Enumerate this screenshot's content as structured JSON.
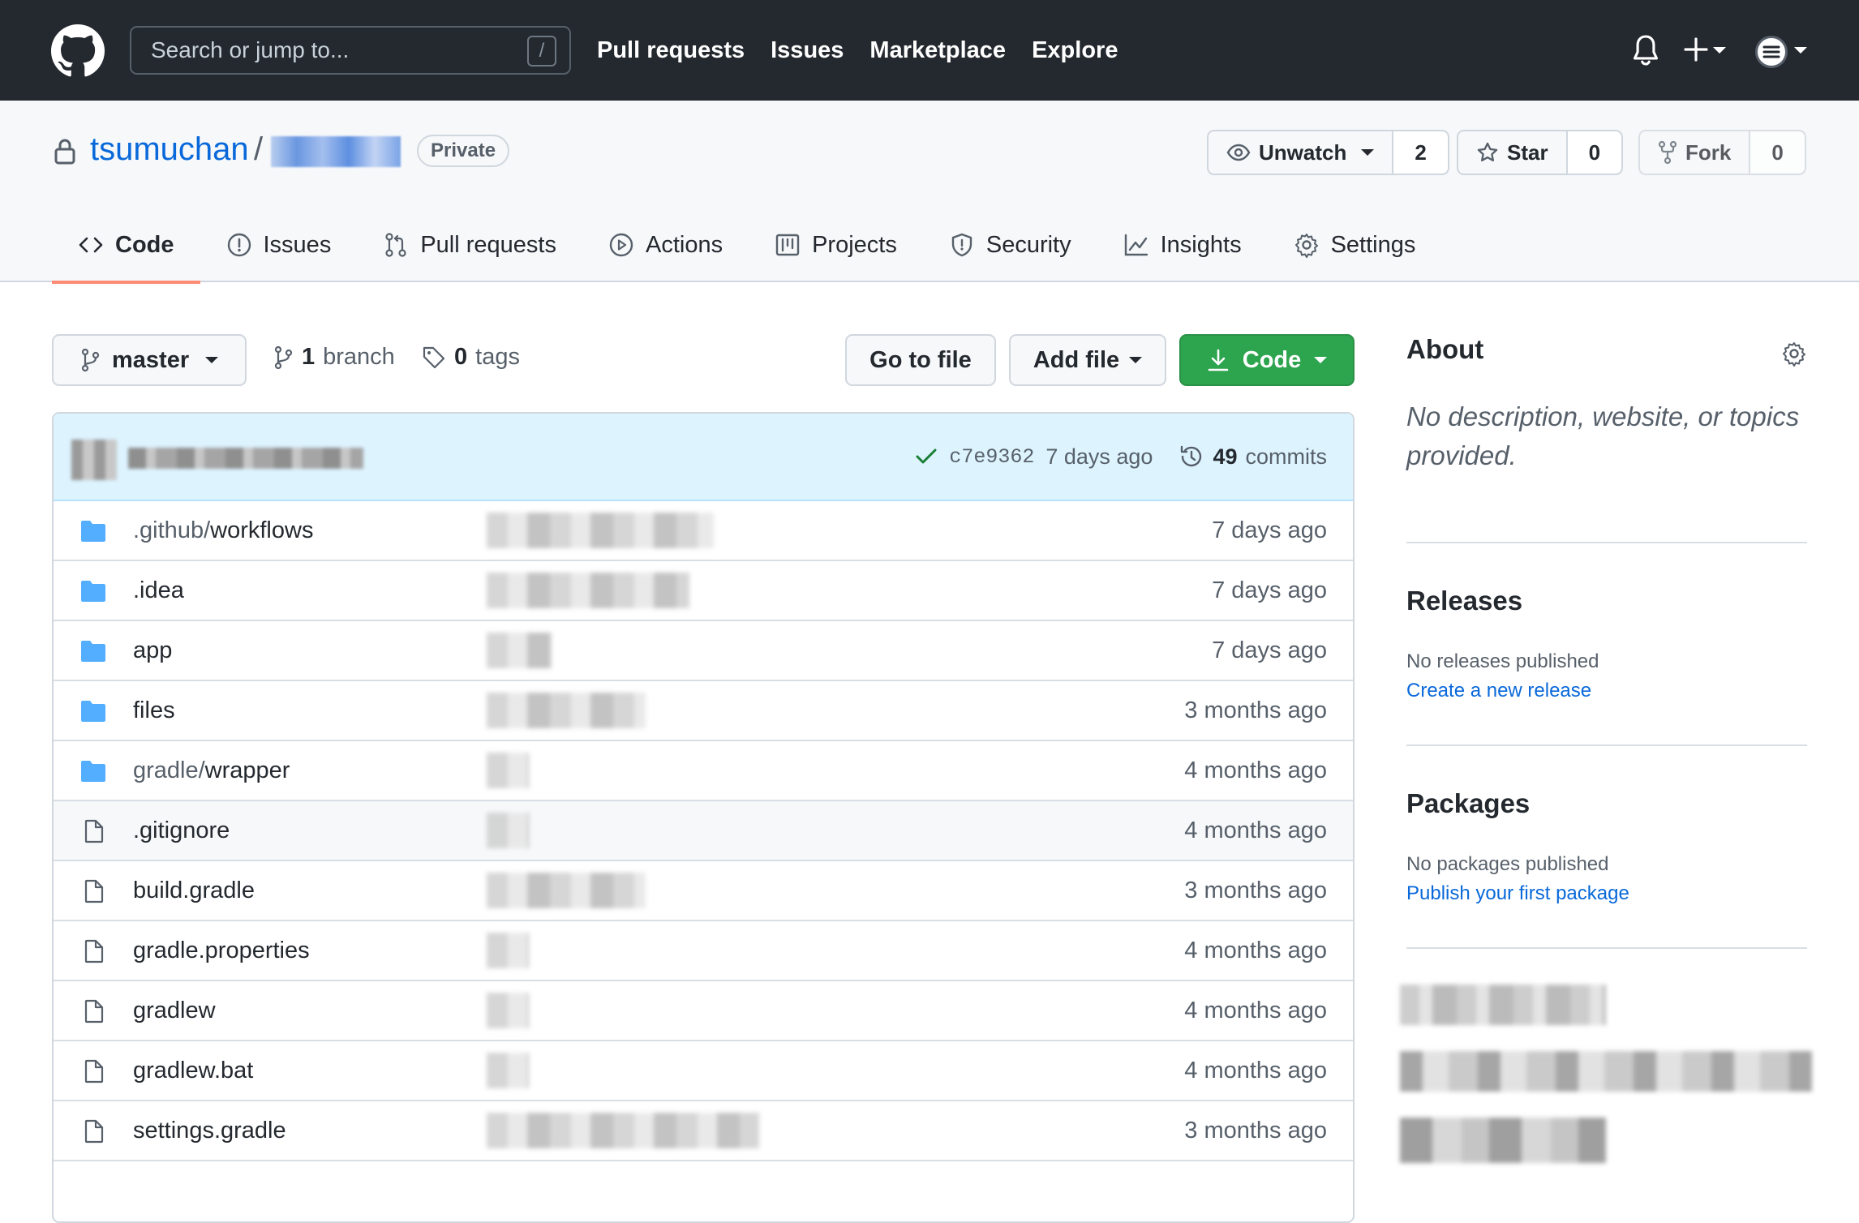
{
  "header": {
    "search_placeholder": "Search or jump to...",
    "search_shortcut": "/",
    "nav": [
      "Pull requests",
      "Issues",
      "Marketplace",
      "Explore"
    ]
  },
  "repo": {
    "owner": "tsumuchan",
    "separator": "/",
    "visibility": "Private",
    "watch": {
      "label": "Unwatch",
      "count": "2"
    },
    "star": {
      "label": "Star",
      "count": "0"
    },
    "fork": {
      "label": "Fork",
      "count": "0"
    },
    "tabs": [
      {
        "label": "Code",
        "icon": "code-icon",
        "active": true
      },
      {
        "label": "Issues",
        "icon": "issue-icon"
      },
      {
        "label": "Pull requests",
        "icon": "pull-request-icon"
      },
      {
        "label": "Actions",
        "icon": "play-icon"
      },
      {
        "label": "Projects",
        "icon": "project-icon"
      },
      {
        "label": "Security",
        "icon": "shield-icon"
      },
      {
        "label": "Insights",
        "icon": "graph-icon"
      },
      {
        "label": "Settings",
        "icon": "gear-icon"
      }
    ]
  },
  "filenav": {
    "branch": "master",
    "branches_count": "1",
    "branches_label": "branch",
    "tags_count": "0",
    "tags_label": "tags",
    "go_to_file": "Go to file",
    "add_file": "Add file",
    "code": "Code"
  },
  "commit": {
    "sha": "c7e9362",
    "age": "7 days ago",
    "count": "49",
    "count_label": "commits"
  },
  "files": [
    {
      "type": "dir",
      "dim": ".github/",
      "name": "workflows",
      "age": "7 days ago"
    },
    {
      "type": "dir",
      "dim": "",
      "name": ".idea",
      "age": "7 days ago"
    },
    {
      "type": "dir",
      "dim": "",
      "name": "app",
      "age": "7 days ago"
    },
    {
      "type": "dir",
      "dim": "",
      "name": "files",
      "age": "3 months ago"
    },
    {
      "type": "dir",
      "dim": "gradle/",
      "name": "wrapper",
      "age": "4 months ago"
    },
    {
      "type": "file",
      "dim": "",
      "name": ".gitignore",
      "age": "4 months ago"
    },
    {
      "type": "file",
      "dim": "",
      "name": "build.gradle",
      "age": "3 months ago"
    },
    {
      "type": "file",
      "dim": "",
      "name": "gradle.properties",
      "age": "4 months ago"
    },
    {
      "type": "file",
      "dim": "",
      "name": "gradlew",
      "age": "4 months ago"
    },
    {
      "type": "file",
      "dim": "",
      "name": "gradlew.bat",
      "age": "4 months ago"
    },
    {
      "type": "file",
      "dim": "",
      "name": "settings.gradle",
      "age": "3 months ago"
    }
  ],
  "sidebar": {
    "about_title": "About",
    "about_desc": "No description, website, or topics provided.",
    "releases_title": "Releases",
    "releases_empty": "No releases published",
    "releases_link": "Create a new release",
    "packages_title": "Packages",
    "packages_empty": "No packages published",
    "packages_link": "Publish your first package"
  },
  "colors": {
    "header_bg": "#24292f",
    "link": "#0969da",
    "green": "#2da44e",
    "tab_underline": "#fd8c73",
    "folder": "#54aeff",
    "commit_bar": "#ddf4ff"
  }
}
